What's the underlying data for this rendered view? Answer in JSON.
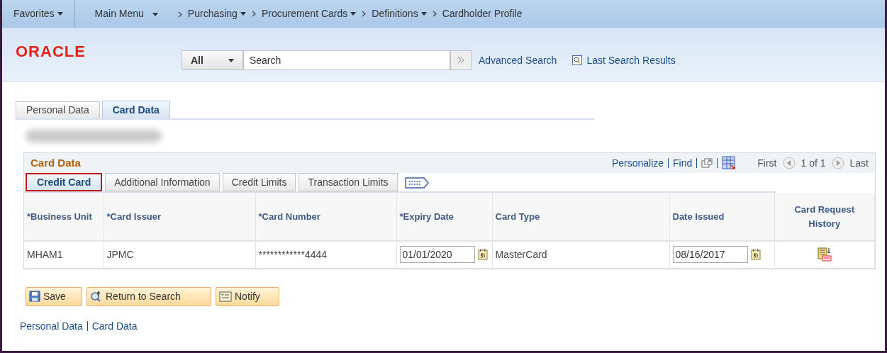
{
  "nav": {
    "favorites": "Favorites",
    "main_menu": "Main Menu",
    "breadcrumb": [
      {
        "label": "Purchasing",
        "dropdown": true
      },
      {
        "label": "Procurement Cards",
        "dropdown": true
      },
      {
        "label": "Definitions",
        "dropdown": true
      },
      {
        "label": "Cardholder Profile",
        "dropdown": false
      }
    ]
  },
  "header": {
    "logo": "ORACLE",
    "search": {
      "scope": "All",
      "placeholder": "Search"
    },
    "advanced_search": "Advanced Search",
    "last_results": "Last Search Results"
  },
  "page_tabs": [
    {
      "label": "Personal Data",
      "selected": false
    },
    {
      "label": "Card Data",
      "selected": true
    }
  ],
  "grid": {
    "title": "Card Data",
    "personalize": "Personalize",
    "find": "Find",
    "pager": {
      "first": "First",
      "position": "1 of 1",
      "last": "Last"
    },
    "tabs": [
      {
        "label": "Credit Card",
        "selected": true,
        "highlighted": true
      },
      {
        "label": "Additional Information",
        "selected": false,
        "highlighted": false
      },
      {
        "label": "Credit Limits",
        "selected": false,
        "highlighted": false
      },
      {
        "label": "Transaction Limits",
        "selected": false,
        "highlighted": false
      }
    ],
    "columns": [
      {
        "label": "*Business Unit"
      },
      {
        "label": "*Card Issuer"
      },
      {
        "label": "*Card Number"
      },
      {
        "label": "*Expiry Date"
      },
      {
        "label": "Card Type"
      },
      {
        "label": "Date Issued"
      },
      {
        "label": "Card Request History"
      }
    ],
    "rows": [
      {
        "cells": [
          {
            "kind": "text",
            "value": "MHAM1"
          },
          {
            "kind": "text",
            "value": "JPMC"
          },
          {
            "kind": "text",
            "value": "************4444"
          },
          {
            "kind": "date",
            "value": "01/01/2020"
          },
          {
            "kind": "text",
            "value": "MasterCard"
          },
          {
            "kind": "date",
            "value": "08/16/2017"
          },
          {
            "kind": "history"
          }
        ]
      }
    ]
  },
  "buttons": [
    {
      "label": "Save",
      "kind": "save"
    },
    {
      "label": "Return to Search",
      "kind": "return"
    },
    {
      "label": "Notify",
      "kind": "notify"
    }
  ],
  "footer_links": [
    "Personal Data",
    "Card Data"
  ]
}
